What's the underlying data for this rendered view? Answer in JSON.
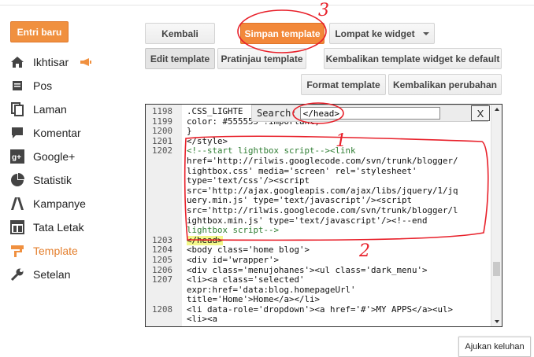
{
  "sidebar": {
    "new_post": "Entri baru",
    "items": [
      {
        "label": "Ikhtisar",
        "icon": "home-icon"
      },
      {
        "label": "Pos",
        "icon": "posts-icon"
      },
      {
        "label": "Laman",
        "icon": "pages-icon"
      },
      {
        "label": "Komentar",
        "icon": "comment-icon"
      },
      {
        "label": "Google+",
        "icon": "google-plus-icon"
      },
      {
        "label": "Statistik",
        "icon": "pie-chart-icon"
      },
      {
        "label": "Kampanye",
        "icon": "campaign-icon"
      },
      {
        "label": "Tata Letak",
        "icon": "layout-icon"
      },
      {
        "label": "Template",
        "icon": "template-icon",
        "active": true
      },
      {
        "label": "Setelan",
        "icon": "wrench-icon"
      }
    ]
  },
  "toolbar": {
    "back": "Kembali",
    "save": "Simpan template",
    "jump": "Lompat ke widget",
    "edit": "Edit template",
    "preview": "Pratinjau template",
    "revert_widgets": "Kembalikan template widget ke default",
    "format": "Format template",
    "revert_changes": "Kembalikan perubahan"
  },
  "search": {
    "label": "Search:",
    "value": "</head>",
    "close": "X"
  },
  "code_lines": [
    {
      "n": "1198",
      "text": ".CSS_LIGHTE"
    },
    {
      "n": "1199",
      "text": "color: #555555 !important;"
    },
    {
      "n": "1200",
      "text": "}"
    },
    {
      "n": "1201",
      "text": "</style>"
    },
    {
      "n": "1202",
      "text": "<!--start lightbox script--><link",
      "style": "green"
    },
    {
      "n": "",
      "text": "href='http://rilwis.googlecode.com/svn/trunk/blogger/"
    },
    {
      "n": "",
      "text": "lightbox.css' media='screen' rel='stylesheet'"
    },
    {
      "n": "",
      "text": "type='text/css'/><script"
    },
    {
      "n": "",
      "text": "src='http://ajax.googleapis.com/ajax/libs/jquery/1/jq"
    },
    {
      "n": "",
      "text": "uery.min.js' type='text/javascript'/><script"
    },
    {
      "n": "",
      "text": "src='http://rilwis.googlecode.com/svn/trunk/blogger/l"
    },
    {
      "n": "",
      "text": "ightbox.min.js' type='text/javascript'/><!--end"
    },
    {
      "n": "",
      "text": "lightbox script-->",
      "style": "green"
    },
    {
      "n": "1203",
      "text": "</head>",
      "style": "hl"
    },
    {
      "n": "1204",
      "text": "<body class='home blog'>"
    },
    {
      "n": "1205",
      "text": "<div id='wrapper'>"
    },
    {
      "n": "1206",
      "text": "<div class='menujohanes'><ul class='dark_menu'>"
    },
    {
      "n": "1207",
      "text": "<li><a class='selected'"
    },
    {
      "n": "",
      "text": "expr:href='data:blog.homepageUrl'"
    },
    {
      "n": "",
      "text": "title='Home'>Home</a></li>"
    },
    {
      "n": "1208",
      "text": "<li data-role='dropdown'><a href='#'>MY APPS</a><ul>"
    },
    {
      "n": "",
      "text": "<li><a"
    }
  ],
  "annotations": {
    "one": "1",
    "two": "2",
    "three": "3"
  },
  "footer": {
    "complaint": "Ajukan keluhan"
  },
  "colors": {
    "accent": "#f0903f",
    "annotation": "#e8202a",
    "highlight": "#f3f88a"
  }
}
